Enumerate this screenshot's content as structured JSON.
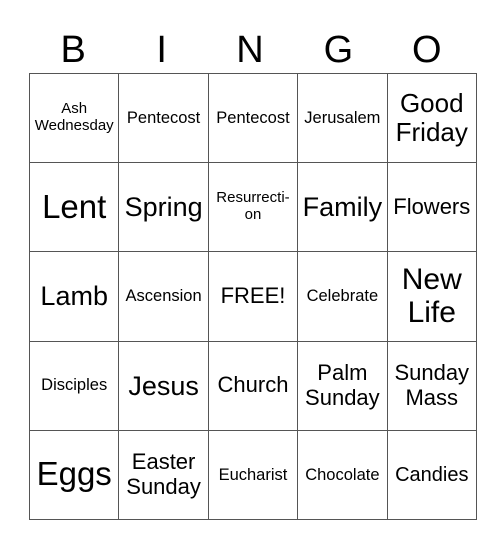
{
  "header": [
    "B",
    "I",
    "N",
    "G",
    "O"
  ],
  "rows": [
    [
      "Ash Wednesday",
      "Pentecost",
      "Pentecost",
      "Jerusalem",
      "Good Friday"
    ],
    [
      "Lent",
      "Spring",
      "Resurrecti-on",
      "Family",
      "Flowers"
    ],
    [
      "Lamb",
      "Ascension",
      "FREE!",
      "Celebrate",
      "New Life"
    ],
    [
      "Disciples",
      "Jesus",
      "Church",
      "Palm Sunday",
      "Sunday Mass"
    ],
    [
      "Eggs",
      "Easter Sunday",
      "Eucharist",
      "Chocolate",
      "Candies"
    ]
  ]
}
